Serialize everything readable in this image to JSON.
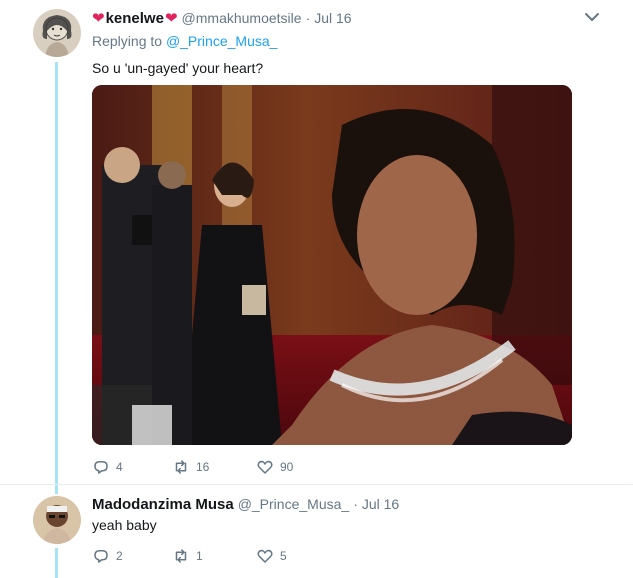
{
  "tweet1": {
    "display_name_prefix": "❤",
    "display_name": "kenelwe",
    "display_name_suffix": "❤",
    "handle": "@mmakhumoetsile",
    "separator": "·",
    "time": "Jul 16",
    "replying_prefix": "Replying to",
    "replying_to": "@_Prince_Musa_",
    "text": "So u 'un-gayed' your heart?",
    "replies": "4",
    "retweets": "16",
    "likes": "90"
  },
  "tweet2": {
    "display_name": "Madodanzima Musa",
    "handle": "@_Prince_Musa_",
    "separator": "·",
    "time": "Jul 16",
    "text": "yeah baby",
    "replies": "2",
    "retweets": "1",
    "likes": "5"
  },
  "icons": {
    "reply": "reply-icon",
    "retweet": "retweet-icon",
    "like": "heart-icon",
    "more": "chevron-down-icon"
  },
  "colors": {
    "link": "#1da1f2",
    "muted": "#657786",
    "thread_line": "#a5e4f5",
    "heart": "#e0245e"
  }
}
